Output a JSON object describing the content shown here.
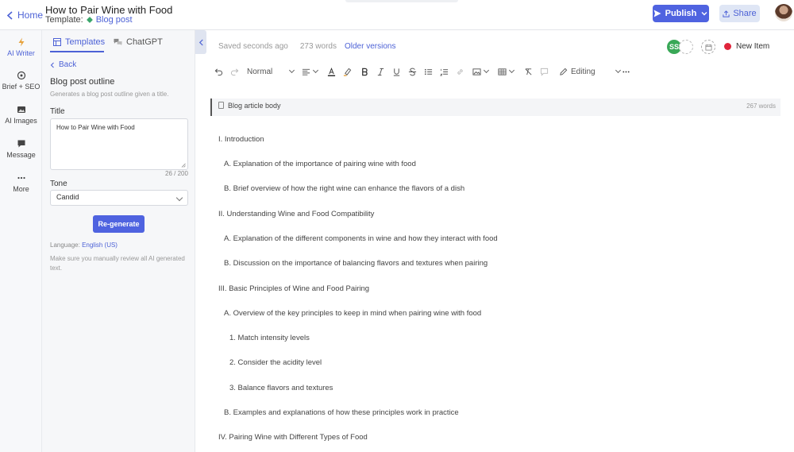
{
  "header": {
    "home_label": "Home",
    "doc_title": "How to Pair Wine with Food",
    "template_prefix": "Template:",
    "template_name": "Blog post",
    "publish_label": "Publish",
    "share_label": "Share"
  },
  "rail": {
    "items": [
      {
        "label": "AI Writer",
        "icon": "lightning-icon"
      },
      {
        "label": "Brief + SEO",
        "icon": "target-icon"
      },
      {
        "label": "AI Images",
        "icon": "image-icon"
      },
      {
        "label": "Message",
        "icon": "chat-icon"
      },
      {
        "label": "More",
        "icon": "more-icon"
      }
    ]
  },
  "panel": {
    "tabs": [
      {
        "label": "Templates"
      },
      {
        "label": "ChatGPT"
      }
    ],
    "back_label": "Back",
    "title": "Blog post outline",
    "subtitle": "Generates a blog post outline given a title.",
    "title_label": "Title",
    "title_value": "How to Pair Wine with Food",
    "counter": "26 / 200",
    "tone_label": "Tone",
    "tone_value": "Candid",
    "regenerate_label": "Re-generate",
    "language_prefix": "Language:",
    "language_value": "English (US)",
    "note": "Make sure you manually review all AI generated text."
  },
  "editor": {
    "saved": "Saved seconds ago",
    "words": "273 words",
    "older_versions": "Older versions",
    "collaborator_initials": "SS",
    "new_item_label": "New Item",
    "toolbar": {
      "style_value": "Normal",
      "mode_value": "Editing"
    },
    "body_label": "Blog article body",
    "body_word_count": "267 words",
    "outline": [
      "I. Introduction",
      "A. Explanation of the importance of pairing wine with food",
      "B. Brief overview of how the right wine can enhance the flavors of a dish",
      "II. Understanding Wine and Food Compatibility",
      "A. Explanation of the different components in wine and how they interact with food",
      "B. Discussion on the importance of balancing flavors and textures when pairing",
      "III. Basic Principles of Wine and Food Pairing",
      "A. Overview of the key principles to keep in mind when pairing wine with food",
      "1. Match intensity levels",
      "2. Consider the acidity level",
      "3. Balance flavors and textures",
      "B. Examples and explanations of how these principles work in practice",
      "IV. Pairing Wine with Different Types of Food"
    ]
  },
  "colors": {
    "accent": "#4f63e0",
    "status_red": "#e0243b",
    "collaborator_green": "#39a857"
  }
}
